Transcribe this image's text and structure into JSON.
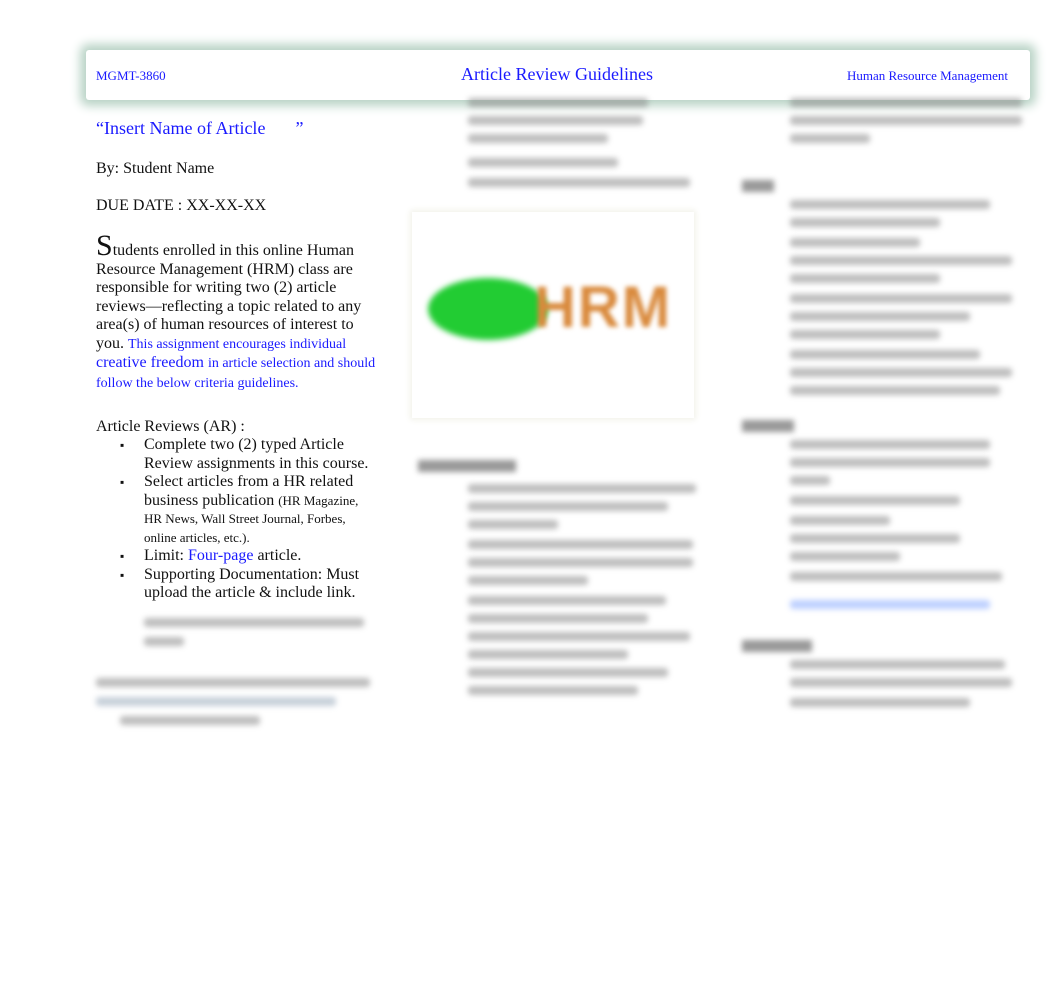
{
  "header": {
    "course": "MGMT-3860",
    "title": "Article Review Guidelines",
    "subject": "Human Resource Management"
  },
  "article": {
    "title_open": "“Insert Name of Article",
    "title_close": "”",
    "by": "By:  Student Name",
    "due": "DUE DATE :  XX-XX-XX"
  },
  "intro": {
    "dropcap": "S",
    "text": "tudents enrolled in this online Human Resource Management (HRM) class are responsible for writing two (2) article reviews—reflecting a topic related  to any area(s) of human resources of interest to you.",
    "blue1": "This assignment encourages individual",
    "blue2": "creative freedom",
    "blue3": "in article selection and should follow the below criteria guidelines."
  },
  "ar": {
    "heading": "Article Reviews (AR) :",
    "items": [
      {
        "text": "Complete two (2) typed Article Review assignments in this course."
      },
      {
        "text": "Select articles from a HR related business publication",
        "small": "(HR Magazine, HR News, Wall Street Journal, Forbes, online articles, etc.)."
      },
      {
        "pre": "Limit:  ",
        "link": "Four-page",
        "post": "  article."
      },
      {
        "text": "Supporting Documentation:  Must upload the article   & include link."
      }
    ]
  },
  "logo": {
    "text": "HRM",
    "green": "#22cc33",
    "orange": "#d98a3d"
  },
  "colors": {
    "accent": "#1a1aff",
    "header_glow": "#b9d3c6"
  }
}
